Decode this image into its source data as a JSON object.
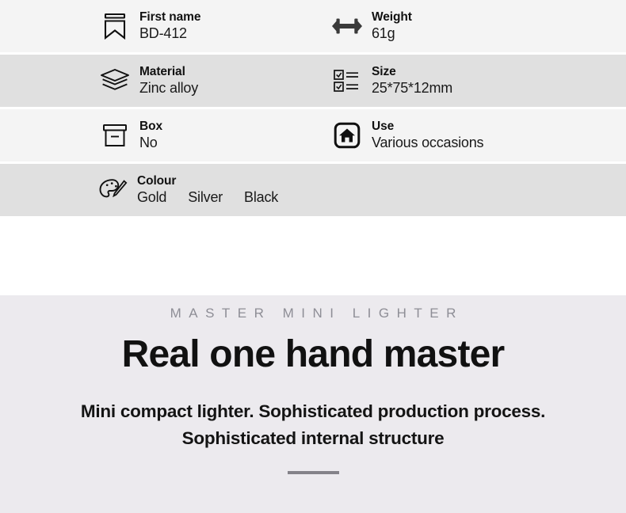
{
  "spec_table": {
    "rows": [
      {
        "tone": "light",
        "cells": [
          {
            "icon": "bookmark-icon",
            "label": "First name",
            "value": "BD-412"
          },
          {
            "icon": "dumbbell-icon",
            "label": "Weight",
            "value": "61g"
          }
        ]
      },
      {
        "tone": "dark",
        "cells": [
          {
            "icon": "layers-icon",
            "label": "Material",
            "value": "Zinc alloy"
          },
          {
            "icon": "checklist-icon",
            "label": "Size",
            "value": "25*75*12mm"
          }
        ]
      },
      {
        "tone": "light",
        "cells": [
          {
            "icon": "box-icon",
            "label": "Box",
            "value": "No"
          },
          {
            "icon": "home-icon",
            "label": "Use",
            "value": "Various occasions"
          }
        ]
      }
    ],
    "colour_row": {
      "tone": "dark",
      "icon": "palette-icon",
      "label": "Colour",
      "values": [
        "Gold",
        "Silver",
        "Black"
      ]
    }
  },
  "banner": {
    "eyebrow": "MASTER MINI LIGHTER",
    "headline": "Real one hand master",
    "body_lines": [
      "Mini compact lighter. Sophisticated production process.",
      "Sophisticated internal structure"
    ]
  },
  "colors": {
    "row_light": "#f4f4f4",
    "row_dark": "#e0e0e0",
    "banner_bg": "#eceaee",
    "eyebrow_text": "#8e8e96",
    "rule": "#848289",
    "icon": "#111111"
  }
}
